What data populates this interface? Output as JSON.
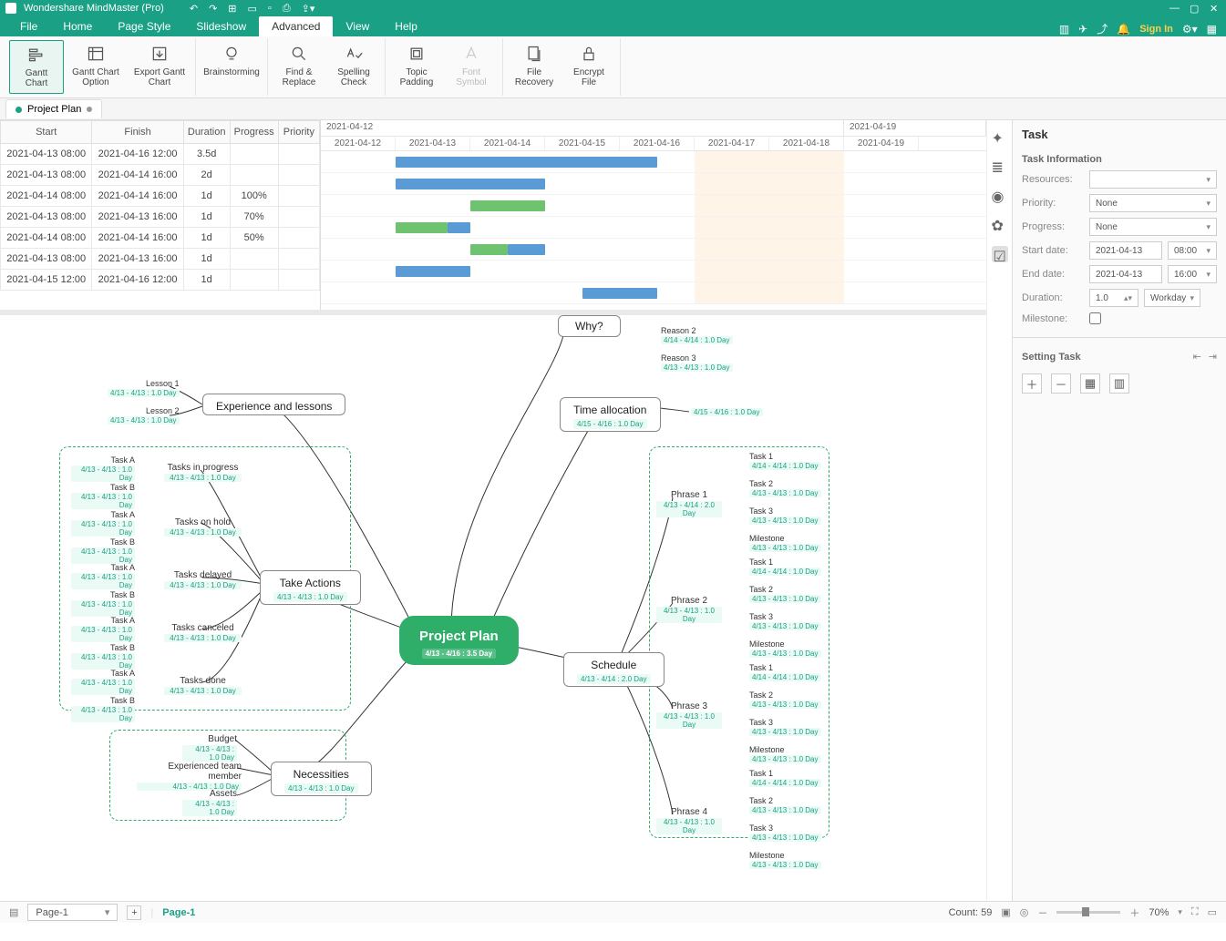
{
  "app": {
    "title": "Wondershare MindMaster (Pro)"
  },
  "menu": {
    "items": [
      "File",
      "Home",
      "Page Style",
      "Slideshow",
      "Advanced",
      "View",
      "Help"
    ],
    "active": "Advanced",
    "signin": "Sign In"
  },
  "ribbon": {
    "gantt_chart": "Gantt\nChart",
    "gantt_option": "Gantt Chart\nOption",
    "export_gantt": "Export Gantt\nChart",
    "brainstorm": "Brainstorming",
    "find_replace": "Find &\nReplace",
    "spelling": "Spelling\nCheck",
    "topic_padding": "Topic\nPadding",
    "font_symbol": "Font\nSymbol",
    "file_recovery": "File\nRecovery",
    "encrypt": "Encrypt\nFile"
  },
  "doc": {
    "name": "Project Plan"
  },
  "gantt": {
    "cols": [
      "Start",
      "Finish",
      "Duration",
      "Progress",
      "Priority"
    ],
    "weeks": [
      "2021-04-12",
      "2021-04-19"
    ],
    "days": [
      "2021-04-12",
      "2021-04-13",
      "2021-04-14",
      "2021-04-15",
      "2021-04-16",
      "2021-04-17",
      "2021-04-18",
      "2021-04-19"
    ],
    "rows": [
      {
        "start": "2021-04-13 08:00",
        "finish": "2021-04-16 12:00",
        "dur": "3.5d",
        "prog": "",
        "bar": [
          82,
          287
        ],
        "p": 0
      },
      {
        "start": "2021-04-13 08:00",
        "finish": "2021-04-14 16:00",
        "dur": "2d",
        "prog": "",
        "bar": [
          82,
          164
        ],
        "p": 0
      },
      {
        "start": "2021-04-14 08:00",
        "finish": "2021-04-14 16:00",
        "dur": "1d",
        "prog": "100%",
        "bar": [
          164,
          82
        ],
        "p": 82
      },
      {
        "start": "2021-04-13 08:00",
        "finish": "2021-04-13 16:00",
        "dur": "1d",
        "prog": "70%",
        "bar": [
          82,
          82
        ],
        "p": 57
      },
      {
        "start": "2021-04-14 08:00",
        "finish": "2021-04-14 16:00",
        "dur": "1d",
        "prog": "50%",
        "bar": [
          164,
          82
        ],
        "p": 41
      },
      {
        "start": "2021-04-13 08:00",
        "finish": "2021-04-13 16:00",
        "dur": "1d",
        "prog": "",
        "bar": [
          82,
          82
        ],
        "p": 0
      },
      {
        "start": "2021-04-15 12:00",
        "finish": "2021-04-16 12:00",
        "dur": "1d",
        "prog": "",
        "bar": [
          287,
          82
        ],
        "p": 0
      }
    ]
  },
  "task": {
    "title": "Task",
    "info": "Task Information",
    "resources": "Resources:",
    "priority": "Priority:",
    "priority_v": "None",
    "progress": "Progress:",
    "progress_v": "None",
    "start": "Start date:",
    "start_d": "2021-04-13",
    "start_t": "08:00",
    "end": "End date:",
    "end_d": "2021-04-13",
    "end_t": "16:00",
    "duration": "Duration:",
    "duration_v": "1.0",
    "duration_u": "Workday",
    "milestone": "Milestone:",
    "setting": "Setting Task"
  },
  "mind": {
    "root": {
      "t": "Project Plan",
      "s": "4/13 - 4/16 : 3.5 Day"
    },
    "why": {
      "t": "Why?",
      "s": ""
    },
    "reasons": [
      {
        "t": "Reason 2",
        "s": "4/14 - 4/14 : 1.0 Day"
      },
      {
        "t": "Reason 3",
        "s": "4/13 - 4/13 : 1.0 Day"
      }
    ],
    "time": {
      "t": "Time allocation",
      "s": "4/15 - 4/16 : 1.0 Day",
      "leaf": "4/15 - 4/16 : 1.0 Day"
    },
    "exp": {
      "t": "Experience and lessons",
      "s": ""
    },
    "lessons": [
      {
        "t": "Lesson 1",
        "s": "4/13 - 4/13 : 1.0 Day"
      },
      {
        "t": "Lesson 2",
        "s": "4/13 - 4/13 : 1.0 Day"
      }
    ],
    "take": {
      "t": "Take Actions",
      "s": "4/13 - 4/13 : 1.0 Day"
    },
    "take_groups": [
      {
        "t": "Tasks in progress",
        "s": "4/13 - 4/13 : 1.0 Day"
      },
      {
        "t": "Tasks on hold",
        "s": "4/13 - 4/13 : 1.0 Day"
      },
      {
        "t": "Tasks delayed",
        "s": "4/13 - 4/13 : 1.0 Day"
      },
      {
        "t": "Tasks canceled",
        "s": "4/13 - 4/13 : 1.0 Day"
      },
      {
        "t": "Tasks done",
        "s": "4/13 - 4/13 : 1.0 Day"
      }
    ],
    "take_leaf": [
      {
        "t": "Task A",
        "s": "4/13 - 4/13 : 1.0 Day"
      },
      {
        "t": "Task B",
        "s": "4/13 - 4/13 : 1.0 Day"
      }
    ],
    "necess": {
      "t": "Necessities",
      "s": "4/13 - 4/13 : 1.0 Day"
    },
    "necess_items": [
      {
        "t": "Budget",
        "s": "4/13 - 4/13 : 1.0 Day"
      },
      {
        "t": "Experienced team member",
        "s": "4/13 - 4/13 : 1.0 Day"
      },
      {
        "t": "Assets",
        "s": "4/13 - 4/13 : 1.0 Day"
      }
    ],
    "schedule": {
      "t": "Schedule",
      "s": "4/13 - 4/14 : 2.0 Day"
    },
    "phrases": [
      {
        "t": "Phrase 1",
        "s": "4/13 - 4/14 : 2.0 Day"
      },
      {
        "t": "Phrase 2",
        "s": "4/13 - 4/13 : 1.0 Day"
      },
      {
        "t": "Phrase 3",
        "s": "4/13 - 4/13 : 1.0 Day"
      },
      {
        "t": "Phrase 4",
        "s": "4/13 - 4/13 : 1.0 Day"
      }
    ],
    "phrase_tasks": [
      {
        "t": "Task 1",
        "s": "4/14 - 4/14 : 1.0 Day"
      },
      {
        "t": "Task 2",
        "s": "4/13 - 4/13 : 1.0 Day"
      },
      {
        "t": "Task 3",
        "s": "4/13 - 4/13 : 1.0 Day"
      },
      {
        "t": "Milestone",
        "s": "4/13 - 4/13 : 1.0 Day"
      }
    ]
  },
  "status": {
    "page": "Page-1",
    "page_btn": "Page-1",
    "count": "Count: 59",
    "zoom": "70%"
  }
}
